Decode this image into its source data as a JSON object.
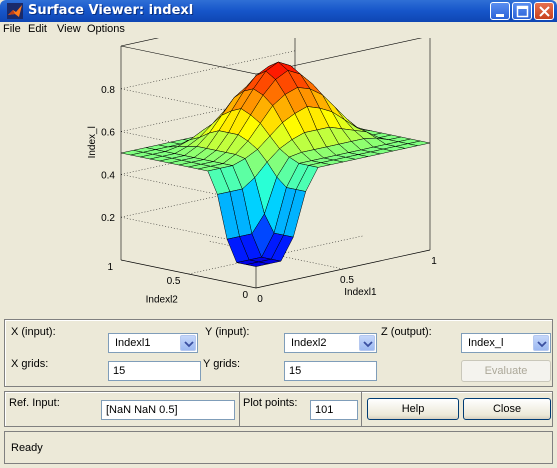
{
  "window": {
    "title": "Surface Viewer: indexl",
    "accent": "#1655c9"
  },
  "menu": [
    "File",
    "Edit",
    "View",
    "Options"
  ],
  "chart_data": {
    "type": "surface",
    "xlabel": "Indexl1",
    "ylabel": "Indexl2",
    "zlabel": "Index_l",
    "x_ticks": [
      "0",
      "0.5",
      "1"
    ],
    "y_ticks": [
      "0",
      "0.5",
      "1"
    ],
    "z_ticks": [
      "0.2",
      "0.4",
      "0.6",
      "0.8"
    ],
    "xlim": [
      0,
      1
    ],
    "ylim": [
      0,
      1
    ],
    "zlim": [
      0,
      1
    ],
    "grid": true,
    "colormap": "jet",
    "grid_points": 15,
    "z_grid": [
      [
        0.1,
        0.1,
        0.1,
        0.2,
        0.4,
        0.5,
        0.5,
        0.5,
        0.5,
        0.5,
        0.5,
        0.5,
        0.5,
        0.5,
        0.5
      ],
      [
        0.1,
        0.1,
        0.1,
        0.2,
        0.4,
        0.5,
        0.5,
        0.5,
        0.5,
        0.5,
        0.5,
        0.5,
        0.5,
        0.5,
        0.5
      ],
      [
        0.1,
        0.1,
        0.1,
        0.2,
        0.4,
        0.5,
        0.5,
        0.5,
        0.5,
        0.5,
        0.5,
        0.5,
        0.5,
        0.5,
        0.5
      ],
      [
        0.2,
        0.2,
        0.2,
        0.28,
        0.44,
        0.52,
        0.53,
        0.53,
        0.53,
        0.53,
        0.53,
        0.53,
        0.52,
        0.5,
        0.5
      ],
      [
        0.4,
        0.4,
        0.4,
        0.44,
        0.5,
        0.55,
        0.58,
        0.6,
        0.6,
        0.6,
        0.58,
        0.56,
        0.54,
        0.5,
        0.5
      ],
      [
        0.5,
        0.5,
        0.5,
        0.52,
        0.55,
        0.6,
        0.65,
        0.68,
        0.7,
        0.68,
        0.65,
        0.6,
        0.55,
        0.5,
        0.5
      ],
      [
        0.5,
        0.5,
        0.5,
        0.53,
        0.58,
        0.65,
        0.72,
        0.76,
        0.78,
        0.76,
        0.72,
        0.65,
        0.58,
        0.52,
        0.5
      ],
      [
        0.5,
        0.5,
        0.5,
        0.53,
        0.6,
        0.68,
        0.76,
        0.82,
        0.85,
        0.82,
        0.76,
        0.68,
        0.6,
        0.53,
        0.5
      ],
      [
        0.5,
        0.5,
        0.5,
        0.53,
        0.6,
        0.7,
        0.78,
        0.85,
        0.88,
        0.85,
        0.78,
        0.7,
        0.6,
        0.53,
        0.5
      ],
      [
        0.5,
        0.5,
        0.5,
        0.53,
        0.6,
        0.68,
        0.76,
        0.82,
        0.85,
        0.82,
        0.76,
        0.68,
        0.6,
        0.53,
        0.5
      ],
      [
        0.5,
        0.5,
        0.5,
        0.53,
        0.58,
        0.65,
        0.72,
        0.76,
        0.78,
        0.76,
        0.72,
        0.65,
        0.58,
        0.52,
        0.5
      ],
      [
        0.5,
        0.5,
        0.5,
        0.52,
        0.55,
        0.6,
        0.65,
        0.68,
        0.7,
        0.68,
        0.65,
        0.6,
        0.55,
        0.5,
        0.5
      ],
      [
        0.5,
        0.5,
        0.5,
        0.51,
        0.53,
        0.56,
        0.58,
        0.6,
        0.6,
        0.6,
        0.58,
        0.56,
        0.53,
        0.5,
        0.5
      ],
      [
        0.5,
        0.5,
        0.5,
        0.5,
        0.5,
        0.5,
        0.5,
        0.5,
        0.5,
        0.5,
        0.5,
        0.5,
        0.5,
        0.5,
        0.5
      ],
      [
        0.5,
        0.5,
        0.5,
        0.5,
        0.5,
        0.5,
        0.5,
        0.5,
        0.5,
        0.5,
        0.5,
        0.5,
        0.5,
        0.5,
        0.5
      ]
    ]
  },
  "controls": {
    "x_input_label": "X (input):",
    "x_input_value": "Indexl1",
    "y_input_label": "Y (input):",
    "y_input_value": "Indexl2",
    "z_output_label": "Z (output):",
    "z_output_value": "Index_l",
    "x_grids_label": "X grids:",
    "x_grids_value": "15",
    "y_grids_label": "Y grids:",
    "y_grids_value": "15",
    "evaluate_label": "Evaluate",
    "ref_input_label": "Ref. Input:",
    "ref_input_value": "[NaN NaN 0.5]",
    "plot_points_label": "Plot points:",
    "plot_points_value": "101",
    "help_label": "Help",
    "close_label": "Close"
  },
  "status": {
    "text": "Ready"
  }
}
